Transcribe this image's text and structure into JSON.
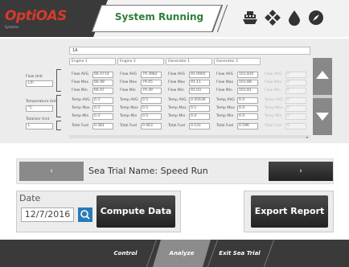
{
  "header": {
    "logo_text": "OptiOAS",
    "logo_sub": "Systems",
    "status": "System Running",
    "icons": [
      "ship-icon",
      "diamond-grid-icon",
      "fuel-drop-icon",
      "compass-icon"
    ]
  },
  "panel": {
    "title": "1A",
    "side": {
      "flow_unit_label": "Flow Unit",
      "flow_unit_value": "L/h",
      "temp_unit_label": "Temperature Unit",
      "temp_unit_value": "°C",
      "totalizer_unit_label": "Totalizer Unit",
      "totalizer_unit_value": "L"
    },
    "row_labels": [
      "Flow AVG",
      "Flow Max",
      "Flow Min",
      "Temp AVG",
      "Temp Max",
      "Temp Min",
      "Total Fuel"
    ],
    "groups": [
      {
        "name": "Engine 1",
        "values": [
          "66.4714",
          "66.48",
          "66.47",
          "0.3",
          "0.3",
          "0.3",
          "0.381"
        ]
      },
      {
        "name": "Engine 2",
        "values": [
          "79.3982",
          "79.45",
          "79.39",
          "0.5",
          "0.5",
          "0.5",
          "0.463"
        ]
      },
      {
        "name": "Generator 1",
        "values": [
          "91.0905",
          "91.11",
          "91.03",
          "0.45636",
          "0.5",
          "0.4",
          "0.531"
        ]
      },
      {
        "name": "Generator 2",
        "values": [
          "101.835",
          "101.88",
          "101.81",
          "0.4",
          "0.4",
          "0.4",
          "0.596"
        ]
      },
      {
        "name": "",
        "values": [
          "0",
          "0",
          "0",
          "0",
          "0",
          "0",
          "0"
        ]
      }
    ]
  },
  "trial": {
    "prev_label": "‹",
    "next_label": "›",
    "name_label": "Sea Trial Name:  Speed Run"
  },
  "controls": {
    "date_label": "Date",
    "date_value": "12/7/2016",
    "compute_label": "Compute Data",
    "export_label": "Export Report"
  },
  "footer": {
    "tabs": [
      "Control",
      "Analyze",
      "Exit Sea Trial"
    ],
    "active": "Analyze"
  },
  "colors": {
    "status_green": "#2f7f3a",
    "logo_red": "#d83a2c",
    "accent_blue": "#2a7ab8"
  }
}
